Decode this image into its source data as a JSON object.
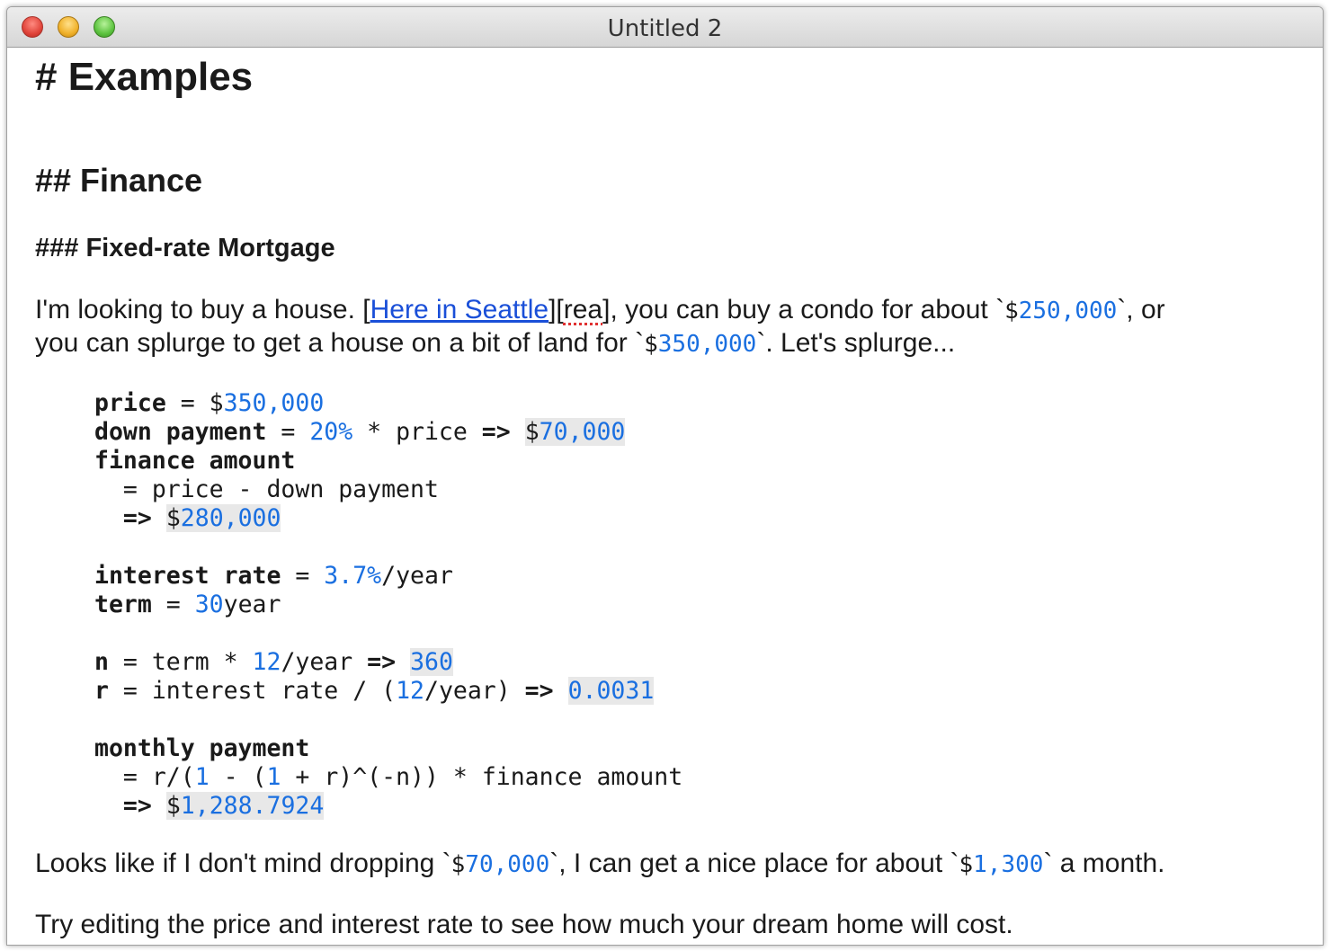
{
  "window": {
    "title": "Untitled 2"
  },
  "doc": {
    "h1": "# Examples",
    "h2": "## Finance",
    "h3": "### Fixed-rate Mortgage",
    "p1": {
      "t1": "I'm looking to buy a house. [",
      "link": "Here in Seattle",
      "t2": "][",
      "ref": "rea",
      "t3": "], you can buy a condo for about `",
      "c1a": "$",
      "c1b": "250,000",
      "t4": "`, or",
      "t5": "you can splurge to get a house on a bit of land for `",
      "c2a": "$",
      "c2b": "350,000",
      "t6": "`. Let's splurge..."
    },
    "code": {
      "l1_var": "price",
      "l1_eq": " = $",
      "l1_num": "350,000",
      "l2_var": "down payment",
      "l2_eq": " = ",
      "l2_pct": "20%",
      "l2_rest": " * price ",
      "l2_arrow": "=>",
      "l2_sp": " ",
      "l2_res_a": "$",
      "l2_res_b": "70,000",
      "l3_var": "finance amount",
      "l4": "  = price - down payment",
      "l5_ind": "  ",
      "l5_arrow": "=>",
      "l5_sp": " ",
      "l5_res_a": "$",
      "l5_res_b": "280,000",
      "l7_var": "interest rate",
      "l7_eq": " = ",
      "l7_num": "3.7%",
      "l7_unit": "/year",
      "l8_var": "term",
      "l8_eq": " = ",
      "l8_num": "30",
      "l8_unit": "year",
      "l10_var": "n",
      "l10_eq": " = term * ",
      "l10_num": "12",
      "l10_unit": "/year ",
      "l10_arrow": "=>",
      "l10_sp": " ",
      "l10_res": "360",
      "l11_var": "r",
      "l11_eq": " = interest rate / (",
      "l11_num": "12",
      "l11_unit": "/year) ",
      "l11_arrow": "=>",
      "l11_sp": " ",
      "l11_res": "0.0031",
      "l13_var": "monthly payment",
      "l14_a": "  = r/(",
      "l14_n1": "1",
      "l14_b": " - (",
      "l14_n2": "1",
      "l14_c": " + r)^(-n)) * finance amount",
      "l15_ind": "  ",
      "l15_arrow": "=>",
      "l15_sp": " ",
      "l15_res_a": "$",
      "l15_res_b": "1,288.7924"
    },
    "p2": {
      "t1": "Looks like if I don't mind dropping `",
      "c1a": "$",
      "c1b": "70,000",
      "t2": "`, I can get a nice place for about `",
      "c2a": "$",
      "c2b": "1,300",
      "t3": "` a month."
    },
    "p3": "Try editing the price and interest rate to see how much your dream home will cost."
  }
}
